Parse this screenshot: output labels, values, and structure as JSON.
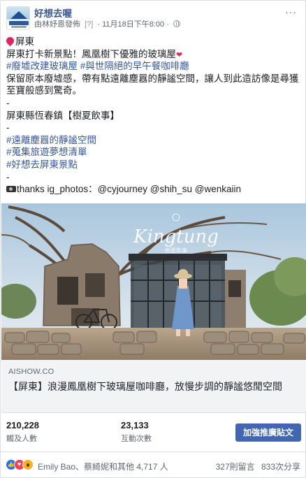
{
  "header": {
    "page_name": "好想去喔",
    "author_prefix": "由林妤恩發佈",
    "help_mark": "[?]",
    "separator": "·",
    "timestamp": "11月18日下午8:00",
    "more": "···"
  },
  "post": {
    "location": "屏東",
    "headline": "屏東打卡新景點！鳳凰樹下優雅的玻璃屋",
    "hashtags_row1": [
      "#廢墟改建玻璃屋",
      "#與世隔絕的早午餐咖啡廳"
    ],
    "description": "保留原本廢墟感，帶有點遠離塵囂的靜謐空間，讓人到此造訪像是尋獲至寶般感到驚奇。",
    "dash": "-",
    "place": "屏東縣恆春鎮【樹夏飲事】",
    "hashtags_block": [
      "#遠離塵囂的靜謐空間",
      "#蒐集旅遊夢想清單",
      "#好想去屏東景點"
    ],
    "credits": "thanks ig_photos：@cyjourney @shih_su @wenkaiin"
  },
  "photo": {
    "alt_script": "Kingtung",
    "sign_text": "樹夏飲事"
  },
  "link": {
    "domain": "AISHOW.CO",
    "title": "【屏東】浪漫鳳凰樹下玻璃屋咖啡廳，放慢步調的靜謐悠閒空間"
  },
  "stats": {
    "reach_value": "210,228",
    "reach_label": "觸及人數",
    "engagement_value": "23,133",
    "engagement_label": "互動次數",
    "boost_label": "加強推廣貼文"
  },
  "reactions": {
    "names_text": "Emily Bao、蔡綺妮和其他 4,717 人",
    "comments_text": "327則留言",
    "shares_text": "833次分享"
  },
  "colors": {
    "brand": "#4267b2",
    "link": "#385898",
    "meta": "#606770"
  }
}
